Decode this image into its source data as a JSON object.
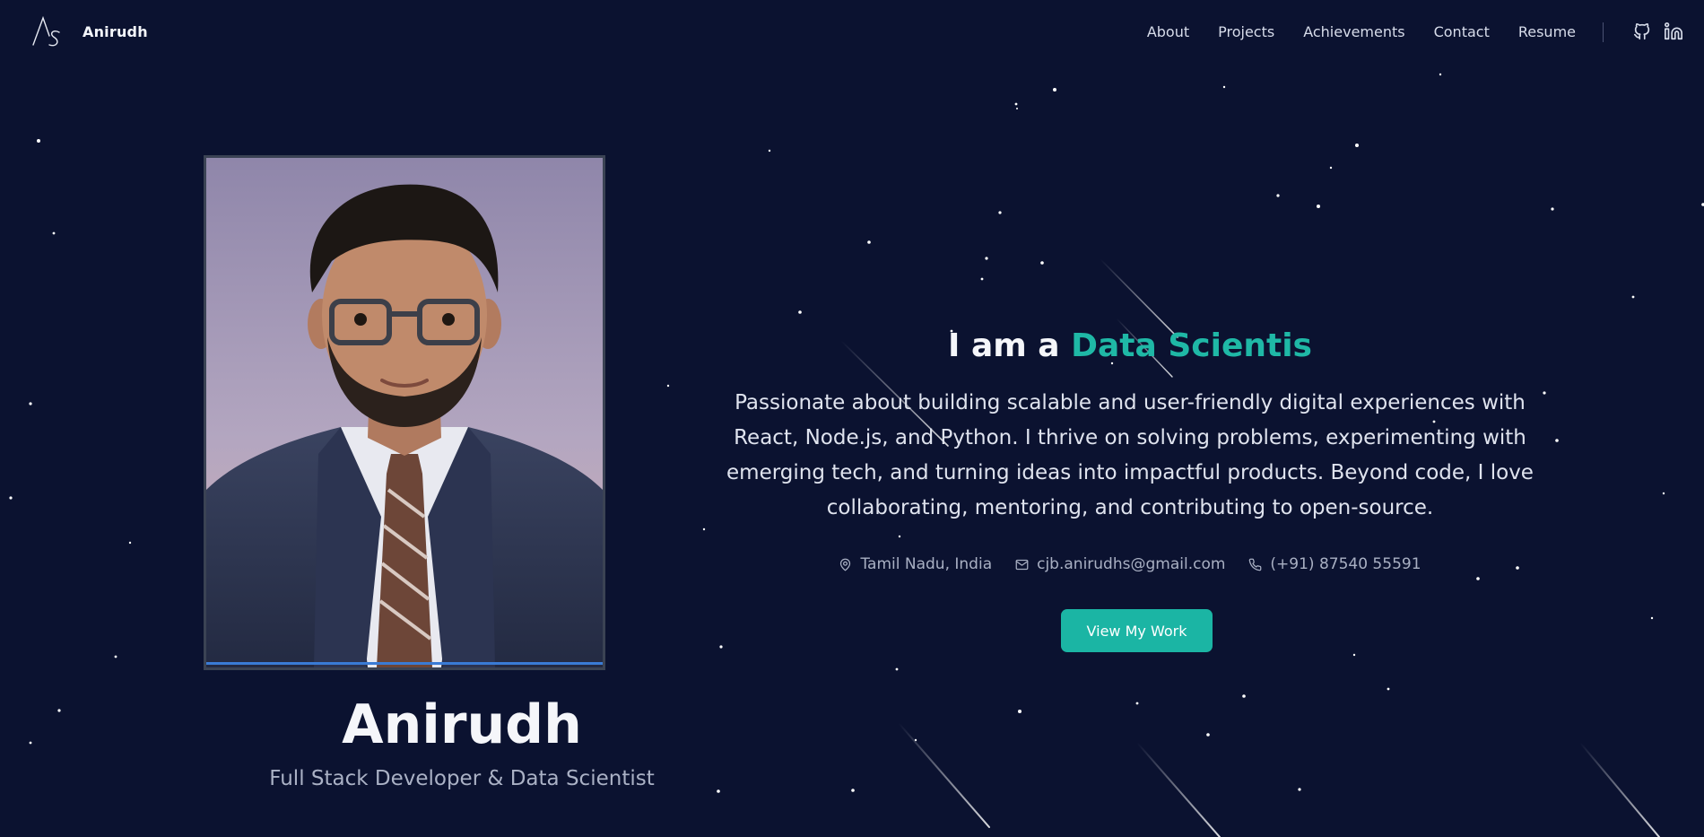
{
  "nav": {
    "brand_name": "Anirudh",
    "links": [
      {
        "label": "About"
      },
      {
        "label": "Projects"
      },
      {
        "label": "Achievements"
      },
      {
        "label": "Contact"
      },
      {
        "label": "Resume"
      }
    ],
    "icons": [
      "github-icon",
      "linkedin-icon"
    ]
  },
  "profile": {
    "name": "Anirudh",
    "title": "Full Stack Developer & Data Scientist"
  },
  "hero": {
    "heading_prefix": "I am a ",
    "heading_role": "Data Scientis",
    "bio": "Passionate about building scalable and user-friendly digital experiences with React, Node.js, and Python. I thrive on solving problems, experimenting with emerging tech, and turning ideas into impactful products. Beyond code, I love collaborating, mentoring, and contributing to open-source.",
    "contacts": {
      "location": "Tamil Nadu, India",
      "email": "cjb.anirudhs@gmail.com",
      "phone": "(+91) 87540 55591"
    },
    "cta_label": "View My Work"
  },
  "colors": {
    "background": "#0b1230",
    "accent": "#1fb8a6",
    "button": "#1bb5a4"
  }
}
